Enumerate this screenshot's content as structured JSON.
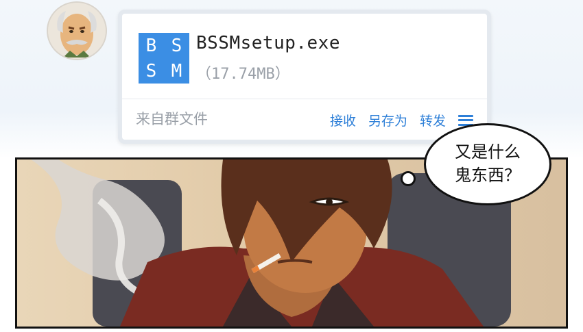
{
  "avatar": {
    "alt": "old man avatar"
  },
  "file_card": {
    "icon_letters": [
      "B",
      "S",
      "S",
      "M"
    ],
    "file_name": "BSSMsetup.exe",
    "file_size": "（17.74MB）",
    "source": "来自群文件",
    "actions": {
      "receive": "接收",
      "save_as": "另存为",
      "forward": "转发"
    }
  },
  "speech": {
    "line1": "又是什么",
    "line2": "鬼东西？"
  },
  "colors": {
    "accent": "#2f80d8",
    "icon_bg": "#3b8ee4"
  }
}
